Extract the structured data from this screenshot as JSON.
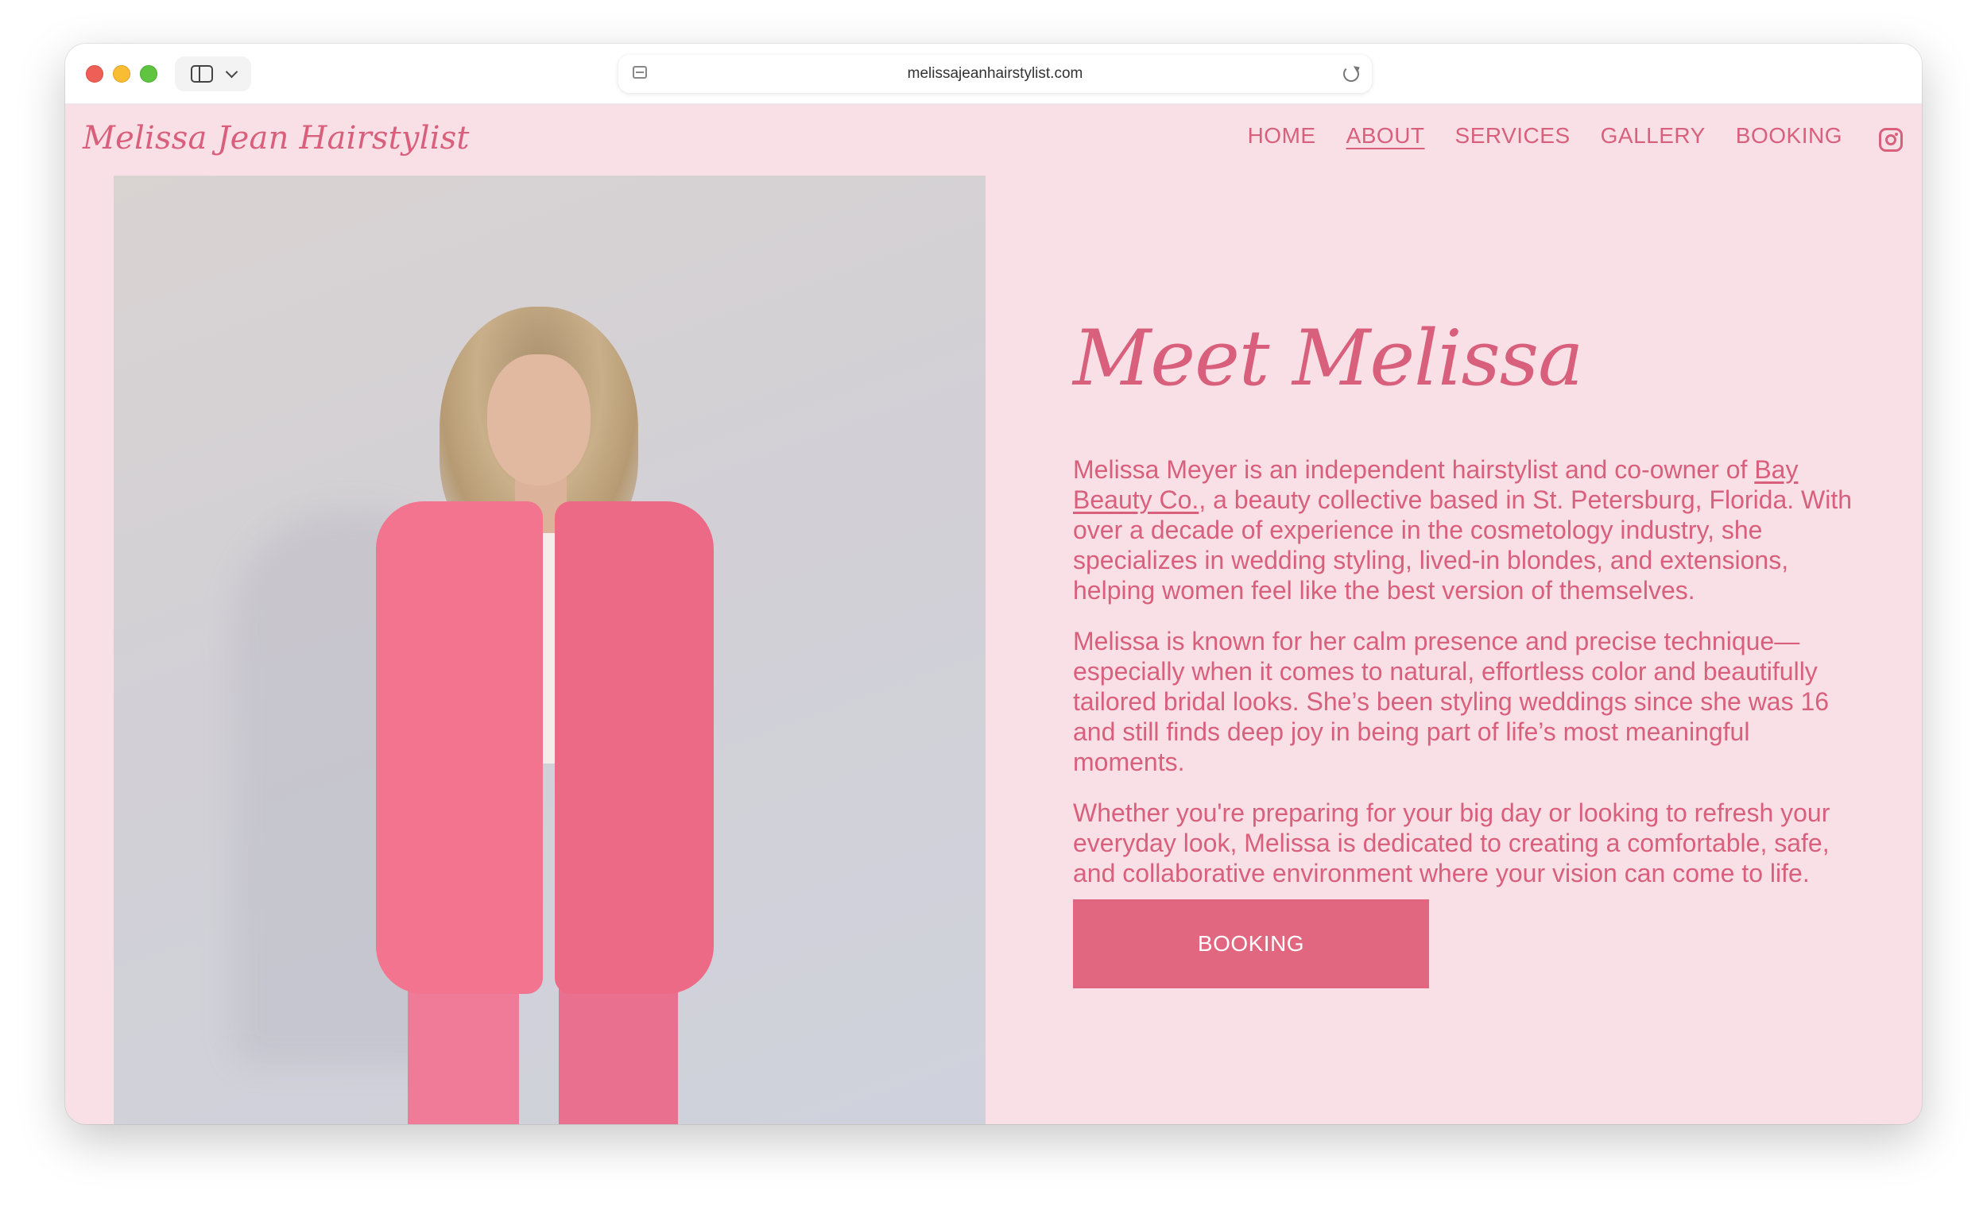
{
  "browser": {
    "url": "melissajeanhairstylist.com"
  },
  "site": {
    "logo": "Melissa Jean Hairstylist",
    "nav": [
      {
        "label": "HOME"
      },
      {
        "label": "ABOUT"
      },
      {
        "label": "SERVICES"
      },
      {
        "label": "GALLERY"
      },
      {
        "label": "BOOKING"
      }
    ]
  },
  "about": {
    "heading": "Meet Melissa",
    "p1_before": "Melissa Meyer is an independent hairstylist and co-owner of ",
    "p1_link": "Bay Beauty Co.",
    "p1_after": ", a beauty collective based in St. Petersburg, Florida. With over a decade of experience in the cosmetology industry, she specializes in wedding styling, lived-in blondes, and extensions, helping women feel like the best version of themselves.",
    "p2": "Melissa is known for her calm presence and precise technique—especially when it comes to natural, effortless color and beautifully tailored bridal looks. She’s been styling weddings since she was 16 and still finds deep joy in being part of life’s most meaningful moments.",
    "p3": "Whether you're preparing for your big day or looking to refresh your everyday look, Melissa is dedicated to creating a comfortable, safe, and collaborative environment where your vision can come to life.",
    "button_label": "BOOKING"
  },
  "colors": {
    "background": "#f9e0e6",
    "accent": "#d8607c",
    "button": "#e0677f"
  }
}
